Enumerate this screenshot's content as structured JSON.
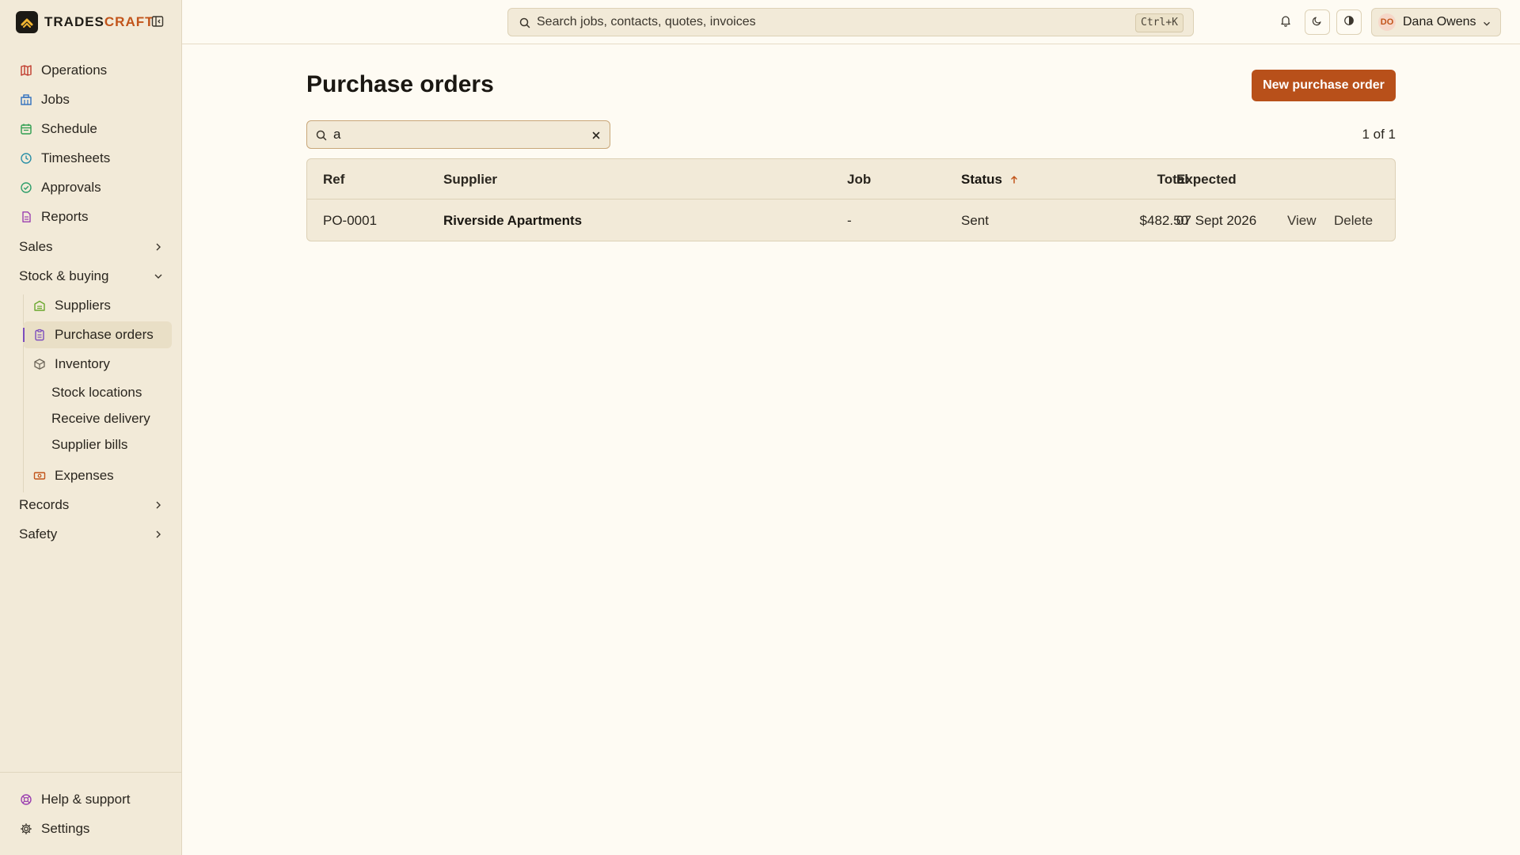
{
  "brand": {
    "name_part1": "TRADES",
    "name_part2": "CRAFT"
  },
  "topbar": {
    "search_placeholder": "Search jobs, contacts, quotes, invoices",
    "shortcut": "Ctrl+K",
    "user": {
      "initials": "DO",
      "name": "Dana Owens"
    }
  },
  "sidebar": {
    "items": [
      {
        "label": "Operations",
        "icon": "map-icon",
        "color": "#c0392b"
      },
      {
        "label": "Jobs",
        "icon": "building-icon",
        "color": "#2f6fbf"
      },
      {
        "label": "Schedule",
        "icon": "calendar-icon",
        "color": "#2e9e4f"
      },
      {
        "label": "Timesheets",
        "icon": "clock-icon",
        "color": "#2a8fa6"
      },
      {
        "label": "Approvals",
        "icon": "check-circle-icon",
        "color": "#2e9e6a"
      },
      {
        "label": "Reports",
        "icon": "document-icon",
        "color": "#9b3fb0"
      }
    ],
    "groups": {
      "sales": "Sales",
      "stock": "Stock & buying",
      "records": "Records",
      "safety": "Safety"
    },
    "stock_items": [
      {
        "label": "Suppliers",
        "icon": "warehouse-icon",
        "color": "#6aa82e"
      },
      {
        "label": "Purchase orders",
        "icon": "clipboard-icon",
        "color": "#7c4dbd"
      },
      {
        "label": "Inventory",
        "icon": "box-icon",
        "color": "#6b6457"
      }
    ],
    "inventory_sub": [
      "Stock locations",
      "Receive delivery",
      "Supplier bills"
    ],
    "expenses": {
      "label": "Expenses",
      "icon": "banknote-icon",
      "color": "#c2541a"
    },
    "bottom": {
      "help": "Help & support",
      "settings": "Settings"
    }
  },
  "main": {
    "title": "Purchase orders",
    "new_button": "New purchase order",
    "filter_value": "a",
    "pager": "1 of 1",
    "columns": {
      "ref": "Ref",
      "supplier": "Supplier",
      "job": "Job",
      "status": "Status",
      "total": "Total",
      "expected": "Expected"
    },
    "rows": [
      {
        "ref": "PO-0001",
        "supplier": "Riverside Apartments",
        "job": "-",
        "status": "Sent",
        "total": "$482.50",
        "expected": "07 Sept 2026",
        "view": "View",
        "delete": "Delete"
      }
    ]
  },
  "colors": {
    "accent": "#b8501a",
    "active_marker": "#7c4dbd",
    "sidebar_bg": "#f2ead8",
    "page_bg": "#fefbf3"
  }
}
